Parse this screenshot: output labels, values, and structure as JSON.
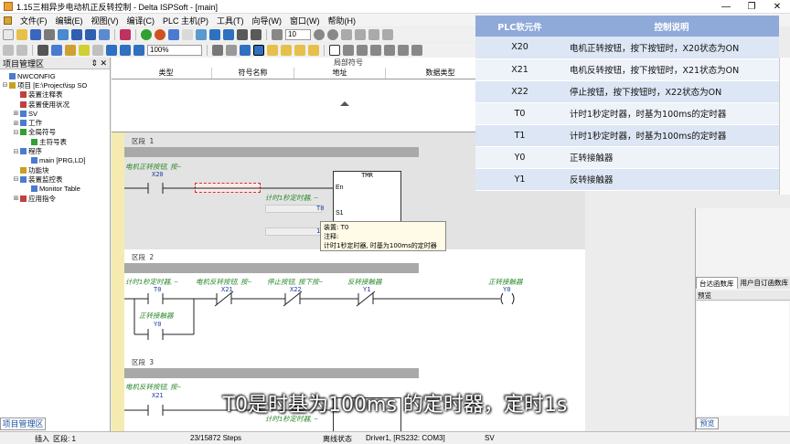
{
  "window": {
    "title": "1.15三相异步电动机正反转控制 - Delta ISPSoft - [main]"
  },
  "menu": [
    "文件(F)",
    "编辑(E)",
    "视图(V)",
    "编译(C)",
    "PLC 主机(P)",
    "工具(T)",
    "向导(W)",
    "窗口(W)",
    "帮助(H)"
  ],
  "toolbar": {
    "step_value": "10",
    "zoom_value": "100%"
  },
  "left_panel": {
    "title": "项目管理区",
    "pin": "⇕ ✕",
    "tree": [
      {
        "label": "NWCONFIG",
        "indent": 0,
        "exp": "",
        "color": "#4a7bd0"
      },
      {
        "label": "项目 [E:\\Project\\isp SO",
        "indent": 0,
        "exp": "⊟",
        "color": "#c8a020"
      },
      {
        "label": "装置注释表",
        "indent": 1,
        "exp": "",
        "color": "#c04040"
      },
      {
        "label": "装置使用状况",
        "indent": 1,
        "exp": "",
        "color": "#c04040"
      },
      {
        "label": "SV",
        "indent": 1,
        "exp": "⊞",
        "color": "#4a7bd0"
      },
      {
        "label": "工作",
        "indent": 1,
        "exp": "⊞",
        "color": "#4a7bd0"
      },
      {
        "label": "全局符号",
        "indent": 1,
        "exp": "⊟",
        "color": "#30a030"
      },
      {
        "label": "主符号表",
        "indent": 2,
        "exp": "",
        "color": "#30a030"
      },
      {
        "label": "程序",
        "indent": 1,
        "exp": "⊟",
        "color": "#4a7bd0"
      },
      {
        "label": "main [PRG,LD]",
        "indent": 2,
        "exp": "",
        "color": "#4a7bd0"
      },
      {
        "label": "功能块",
        "indent": 1,
        "exp": "",
        "color": "#c8a020"
      },
      {
        "label": "装置监控表",
        "indent": 1,
        "exp": "⊟",
        "color": "#4a7bd0"
      },
      {
        "label": "Monitor Table",
        "indent": 2,
        "exp": "",
        "color": "#4a7bd0"
      },
      {
        "label": "应用指令",
        "indent": 1,
        "exp": "⊞",
        "color": "#c04040"
      }
    ],
    "tab": "项目管理区"
  },
  "var_table": {
    "title": "局部符号",
    "cols": [
      "类型",
      "符号名称",
      "地址",
      "数据类型"
    ]
  },
  "ladder": {
    "rung1": {
      "label": "区段 1",
      "comment1": "电机正转按钮, 按~",
      "contact": "X20",
      "comment2": "计时1秒定时器, ~",
      "timer_dev": "T0",
      "block": "TMR",
      "en": "En",
      "s1": "S1",
      "s2_val": "1"
    },
    "rung2": {
      "label": "区段 2",
      "comment_a": "计时1秒定时器, ~",
      "comment_b": "电机反转按钮, 按~",
      "comment_c": "停止按钮, 按下按~",
      "comment_d": "反转接触器",
      "comment_e": "正转接触器",
      "comment_f": "正转接触器",
      "c1": "T0",
      "c2": "X21",
      "c3": "X22",
      "c4": "Y1",
      "coil": "Y0",
      "branch": "Y0"
    },
    "rung3": {
      "label": "区段 3",
      "comment1": "电机反转按钮, 按~",
      "contact": "X21",
      "comment2": "计时1秒定时器, ~",
      "block": "TMR"
    }
  },
  "tooltip": {
    "line1": "装置: T0",
    "line2": "注释:",
    "line3": "计时1秒定时器, 时基为100ms的定时器"
  },
  "table": {
    "headers": [
      "PLC软元件",
      "控制说明"
    ],
    "rows": [
      [
        "X20",
        "电机正转按钮，按下按钮时，X20状态为ON"
      ],
      [
        "X21",
        "电机反转按钮，按下按钮时，X21状态为ON"
      ],
      [
        "X22",
        "停止按钮，按下按钮时，X22状态为ON"
      ],
      [
        "T0",
        "计时1秒定时器，时基为100ms的定时器"
      ],
      [
        "T1",
        "计时1秒定时器，时基为100ms的定时器"
      ],
      [
        "Y0",
        "正转接触器"
      ],
      [
        "Y1",
        "反转接触器"
      ]
    ]
  },
  "right_panel": {
    "tab1": "台达函数库",
    "tab2": "用户自订函数库",
    "preview": "预览",
    "preview_tab": "预览"
  },
  "status": {
    "mode": "插入",
    "rung": "区段: 1",
    "steps": "23/15872 Steps",
    "state": "离线状态",
    "driver": "Driver1, [RS232: COM3]",
    "sv": "SV"
  },
  "subtitle": "T0是时基为100ms 的定时器，定时1s"
}
